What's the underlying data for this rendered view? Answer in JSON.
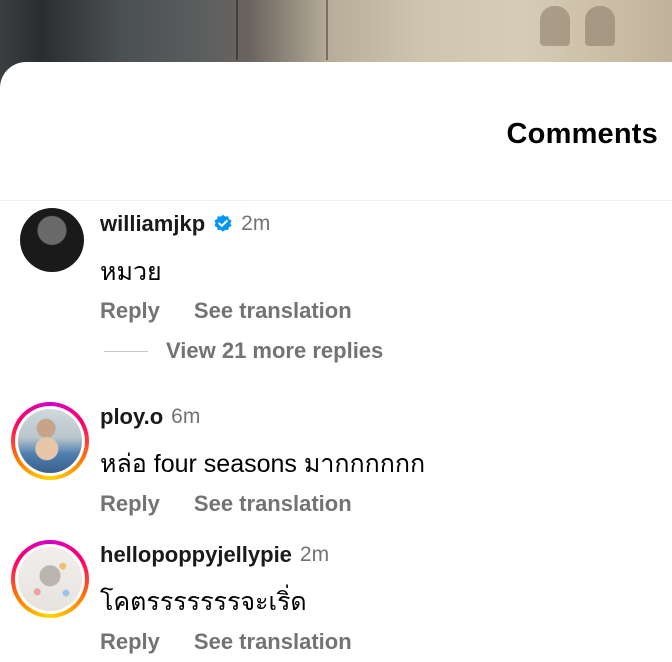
{
  "header": {
    "title": "Comments"
  },
  "comments": [
    {
      "username": "williamjkp",
      "verified": true,
      "time": "2m",
      "text": "หมวย",
      "reply_label": "Reply",
      "translate_label": "See translation",
      "more_replies_label": "View 21 more replies"
    },
    {
      "username": "ploy.o",
      "verified": false,
      "time": "6m",
      "text": "หล่อ four seasons มากกกกกก",
      "reply_label": "Reply",
      "translate_label": "See translation"
    },
    {
      "username": "hellopoppyjellypie",
      "verified": false,
      "time": "2m",
      "text": "โคตรรรรรรรจะเริ่ด",
      "reply_label": "Reply",
      "translate_label": "See translation"
    }
  ],
  "colors": {
    "verified_badge": "#0095f6",
    "secondary_text": "#737373",
    "story_ring": [
      "#d300c5",
      "#ff0069",
      "#ff7a00",
      "#ffd600"
    ]
  },
  "icons": {
    "verified": "verified-badge-icon"
  }
}
